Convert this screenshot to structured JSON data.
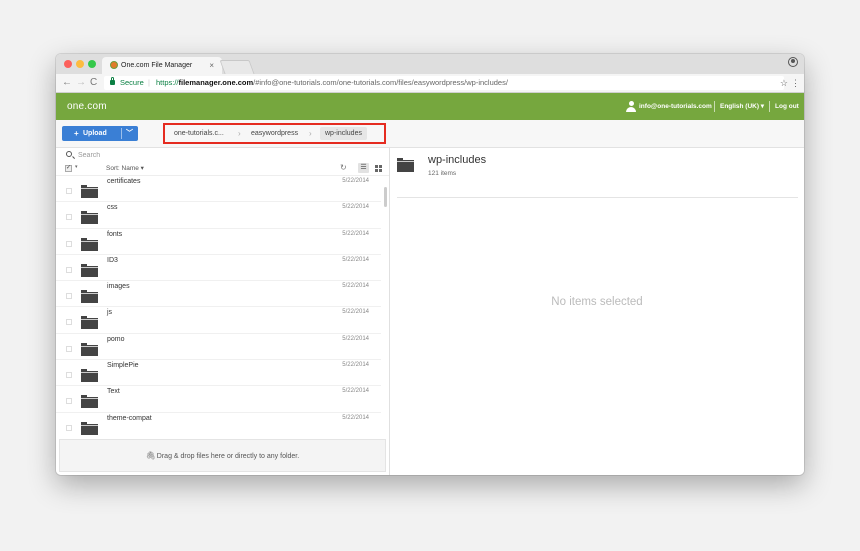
{
  "browser": {
    "tab_title": "One.com File Manager",
    "tab_close": "×",
    "secure_label": "Secure",
    "url_scheme": "https://",
    "url_host": "filemanager.one.com",
    "url_path": "/#info@one-tutorials.com/one-tutorials.com/files/easywordpress/wp-includes/"
  },
  "header": {
    "logo": "one.com",
    "user_email": "info@one-tutorials.com",
    "language": "English (UK) ▾",
    "logout": "Log out",
    "brand_color": "#76a73e"
  },
  "toolbar": {
    "upload_label": "Upload",
    "breadcrumb": [
      "one-tutorials.c...",
      "easywordpress",
      "wp-includes"
    ],
    "highlight_color": "#e52b20"
  },
  "left_pane": {
    "search_placeholder": "Search",
    "sort_label": "Sort: Name ▾",
    "files": [
      {
        "name": "certificates",
        "date": "5/22/2014"
      },
      {
        "name": "css",
        "date": "5/22/2014"
      },
      {
        "name": "fonts",
        "date": "5/22/2014"
      },
      {
        "name": "ID3",
        "date": "5/22/2014"
      },
      {
        "name": "images",
        "date": "5/22/2014"
      },
      {
        "name": "js",
        "date": "5/22/2014"
      },
      {
        "name": "pomo",
        "date": "5/22/2014"
      },
      {
        "name": "SimplePie",
        "date": "5/22/2014"
      },
      {
        "name": "Text",
        "date": "5/22/2014"
      },
      {
        "name": "theme-compat",
        "date": "5/22/2014"
      }
    ],
    "dropzone_text": "Drag & drop files here or directly to any folder."
  },
  "right_pane": {
    "folder_title": "wp-includes",
    "item_count": "121 items",
    "empty_message": "No items selected"
  }
}
